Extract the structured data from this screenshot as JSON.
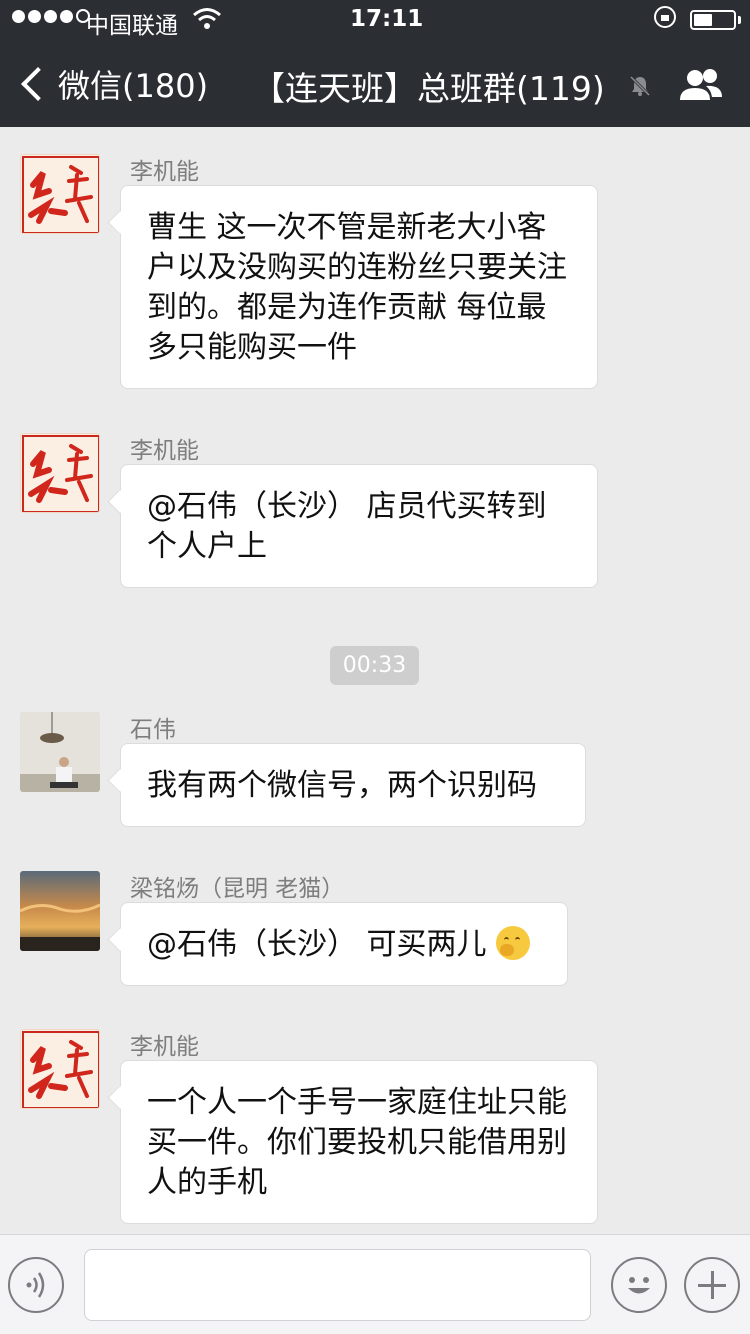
{
  "status_bar": {
    "carrier": "中国联通",
    "time": "17:11",
    "signal_bars_filled": 4,
    "signal_bars_total": 5
  },
  "nav": {
    "back_label": "微信(180)",
    "title": "【连天班】总班群(119)",
    "icons": {
      "back": "chevron-left-icon",
      "mute": "bell-muted-icon",
      "members": "group-members-icon"
    }
  },
  "messages": [
    {
      "sender": "李机能",
      "avatar": "red-calligraphy-avatar",
      "text": "曹生 这一次不管是新老大小客户以及没购买的连粉丝只要关注到的。都是为连作贡献  每位最多只能购买一件"
    },
    {
      "sender": "李机能",
      "avatar": "red-calligraphy-avatar",
      "text": "@石伟（长沙） 店员代买转到个人户上"
    },
    {
      "sender": "石伟",
      "avatar": "photo-avatar-room",
      "text": "我有两个微信号，两个识别码"
    },
    {
      "sender": "梁铭炀（昆明 老猫）",
      "avatar": "photo-avatar-sky",
      "text": "@石伟（长沙） 可买两儿",
      "emoji": "thinking-face-emoji"
    },
    {
      "sender": "李机能",
      "avatar": "red-calligraphy-avatar",
      "text": "一个人一个手号一家庭住址只能买一件。你们要投机只能借用别人的手机"
    }
  ],
  "timestamp": "00:33",
  "input_bar": {
    "placeholder": "",
    "icons": {
      "voice": "voice-icon",
      "emoji": "emoji-icon",
      "more": "plus-icon"
    }
  },
  "colors": {
    "nav_background": "#2b2e33",
    "chat_background": "#ebebeb",
    "bubble_background": "#ffffff",
    "sender_text": "#7e7e7e"
  }
}
